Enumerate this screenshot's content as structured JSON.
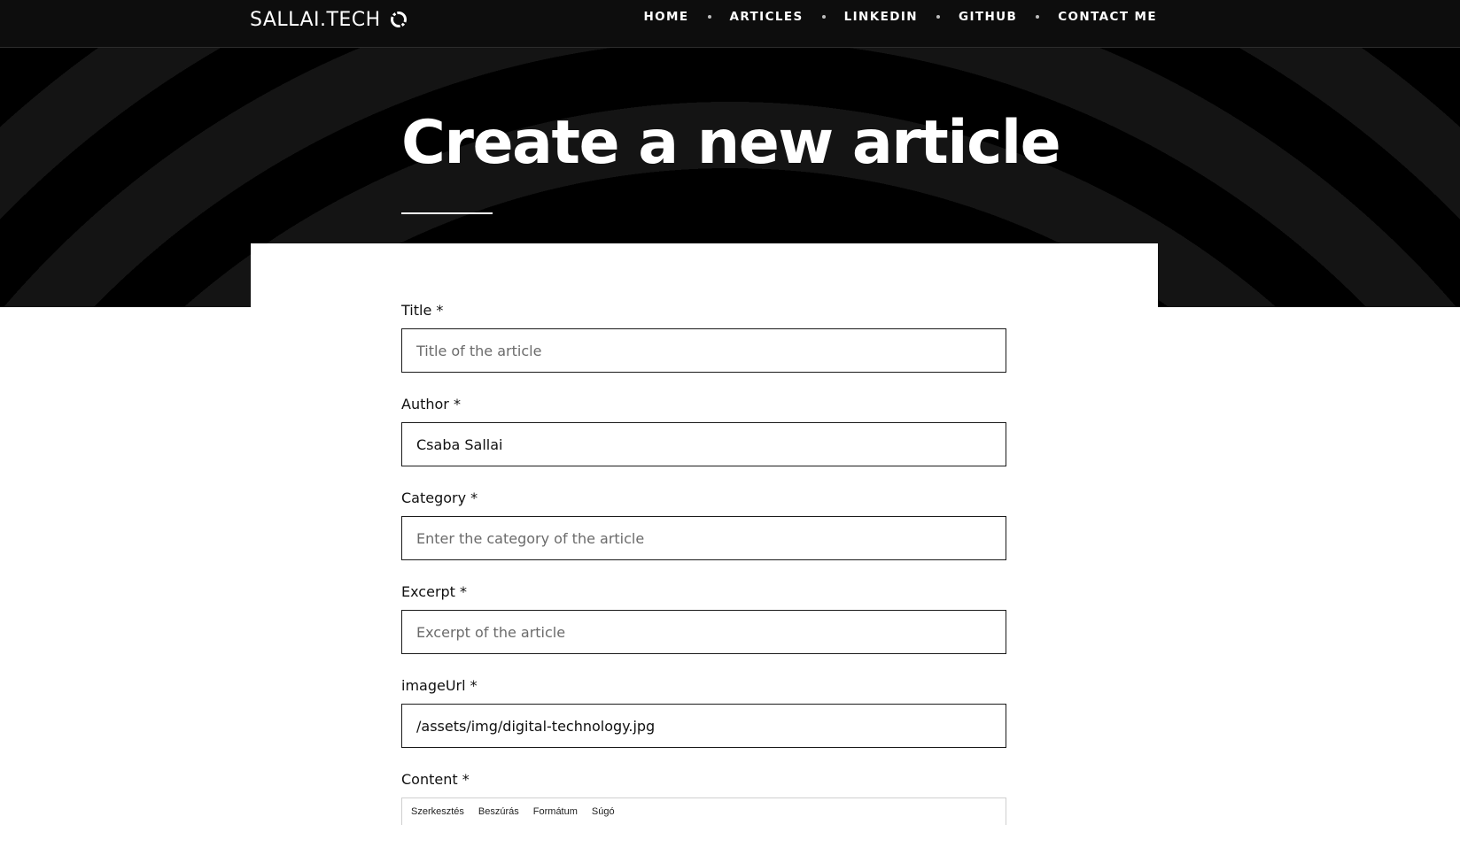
{
  "brand": {
    "name": "SALLAI.TECH",
    "logo_icon": "circular-arrows-icon"
  },
  "nav": {
    "items": [
      {
        "label": "HOME"
      },
      {
        "label": "ARTICLES"
      },
      {
        "label": "LINKEDIN"
      },
      {
        "label": "GITHUB"
      },
      {
        "label": "CONTACT ME"
      }
    ]
  },
  "hero": {
    "title": "Create a new article"
  },
  "form": {
    "title": {
      "label": "Title *",
      "value": "",
      "placeholder": "Title of the article"
    },
    "author": {
      "label": "Author *",
      "value": "Csaba Sallai",
      "placeholder": ""
    },
    "category": {
      "label": "Category *",
      "value": "",
      "placeholder": "Enter the category of the article"
    },
    "excerpt": {
      "label": "Excerpt *",
      "value": "",
      "placeholder": "Excerpt of the article"
    },
    "image_url": {
      "label": "imageUrl *",
      "value": "/assets/img/digital-technology.jpg",
      "placeholder": ""
    },
    "content": {
      "label": "Content *",
      "menu": [
        "Szerkesztés",
        "Beszúrás",
        "Formátum",
        "Súgó"
      ]
    }
  },
  "colors": {
    "hero_background": "#000000",
    "ring": "#141414",
    "text_light": "#ffffff",
    "text_dark": "#111111"
  }
}
